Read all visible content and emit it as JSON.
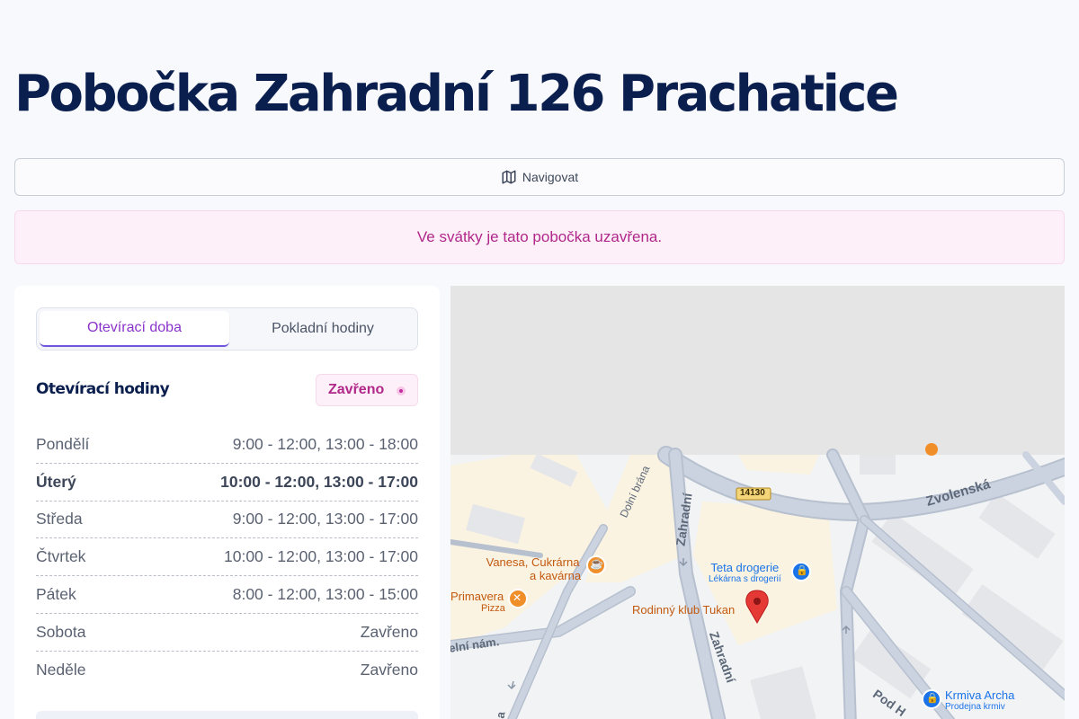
{
  "page": {
    "title": "Pobočka Zahradní 126 Prachatice"
  },
  "navigate": {
    "label": "Navigovat",
    "icon": "map-icon"
  },
  "alert": {
    "text": "Ve svátky je tato pobočka uzavřena."
  },
  "tabs": [
    {
      "label": "Otevírací doba",
      "active": true
    },
    {
      "label": "Pokladní hodiny",
      "active": false
    }
  ],
  "hours": {
    "title": "Otevírací hodiny",
    "status": "Zavřeno",
    "rows": [
      {
        "day": "Pondělí",
        "time": "9:00 - 12:00, 13:00 - 18:00"
      },
      {
        "day": "Úterý",
        "time": "10:00 - 12:00, 13:00 - 17:00",
        "today": true
      },
      {
        "day": "Středa",
        "time": "9:00 - 12:00, 13:00 - 17:00"
      },
      {
        "day": "Čtvrtek",
        "time": "10:00 - 12:00, 13:00 - 17:00"
      },
      {
        "day": "Pátek",
        "time": "8:00 - 12:00, 13:00 - 15:00"
      },
      {
        "day": "Sobota",
        "time": "Zavřeno"
      },
      {
        "day": "Neděle",
        "time": "Zavřeno"
      }
    ]
  },
  "map": {
    "streets": [
      "Zvolenská",
      "Zahradní",
      "Zahradní",
      "Dolní brána",
      "Pod H",
      "elní nám.",
      "a"
    ],
    "road_number": "14130",
    "pois": [
      {
        "name": "Vanesa, Cukrárna",
        "name2": "a kavárna",
        "icon": "cafe-icon"
      },
      {
        "name": "Primavera",
        "sub": "Pizza",
        "icon": "restaurant-icon"
      },
      {
        "name": "Teta drogerie",
        "sub": "Lékárna s drogerií",
        "icon": "shopping-icon"
      },
      {
        "name": "Rodinný klub Tukan",
        "icon": "poi-icon"
      },
      {
        "name": "Krmiva Archa",
        "sub": "Prodejna krmiv",
        "icon": "shopping-icon"
      }
    ],
    "colors": {
      "road": "#ccd3e0",
      "road_edge": "#b7c0cf",
      "building": "#e5e6ea",
      "block": "#fbf3e1",
      "pin": "#e53935",
      "poi_orange": "#f08f2a",
      "poi_blue": "#1a73e8"
    }
  }
}
